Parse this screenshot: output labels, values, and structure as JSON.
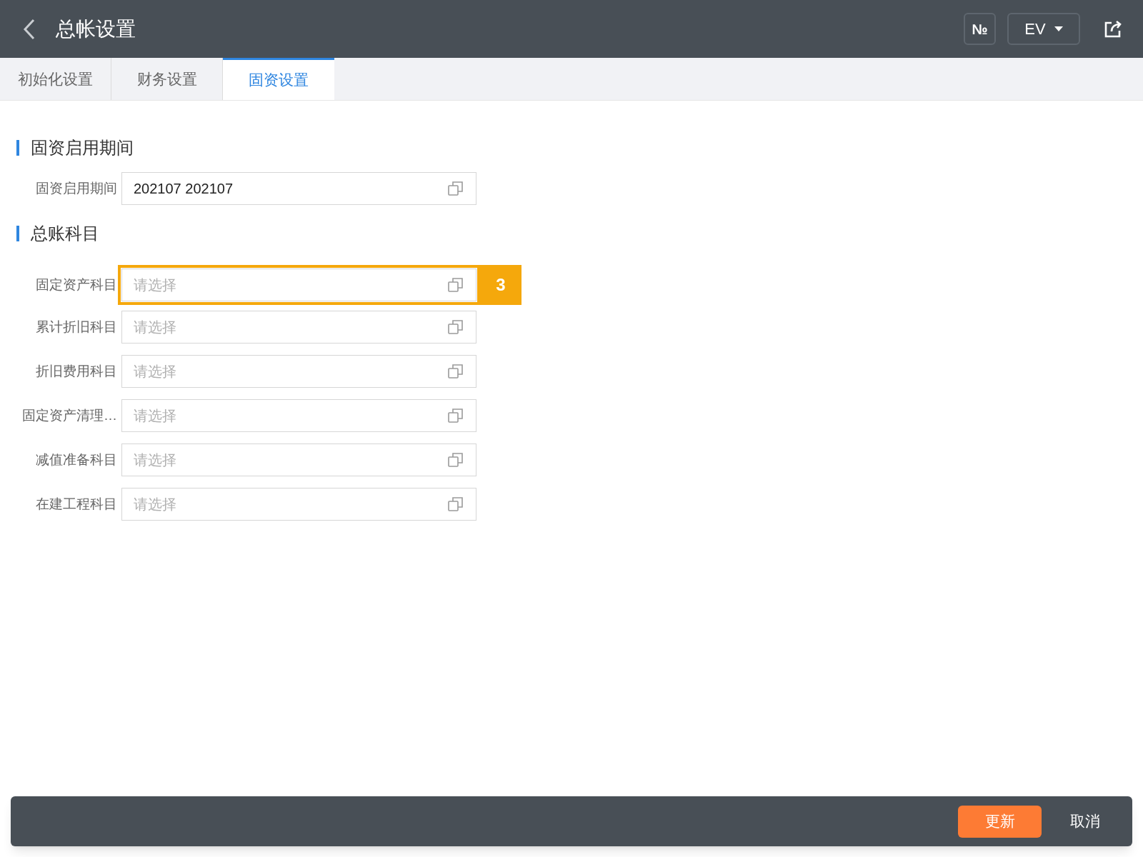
{
  "header": {
    "title": "总帐设置",
    "number_button": "№",
    "language": "EV"
  },
  "tabs": [
    {
      "label": "初始化设置",
      "selected": false
    },
    {
      "label": "财务设置",
      "selected": false
    },
    {
      "label": "固资设置",
      "selected": true
    }
  ],
  "sections": [
    {
      "title": "固资启用期间",
      "fields": [
        {
          "label": "固资启用期间",
          "value": "202107 202107",
          "highlighted": false
        }
      ]
    },
    {
      "title": "总账科目",
      "fields": [
        {
          "label": "固定资产科目",
          "placeholder": "请选择",
          "highlighted": true,
          "callout": "3"
        },
        {
          "label": "累计折旧科目",
          "placeholder": "请选择",
          "highlighted": false
        },
        {
          "label": "折旧费用科目",
          "placeholder": "请选择",
          "highlighted": false
        },
        {
          "label": "固定资产清理…",
          "placeholder": "请选择",
          "highlighted": false
        },
        {
          "label": "减值准备科目",
          "placeholder": "请选择",
          "highlighted": false
        },
        {
          "label": "在建工程科目",
          "placeholder": "请选择",
          "highlighted": false
        }
      ]
    }
  ],
  "footer": {
    "primary": "更新",
    "secondary": "取消"
  }
}
